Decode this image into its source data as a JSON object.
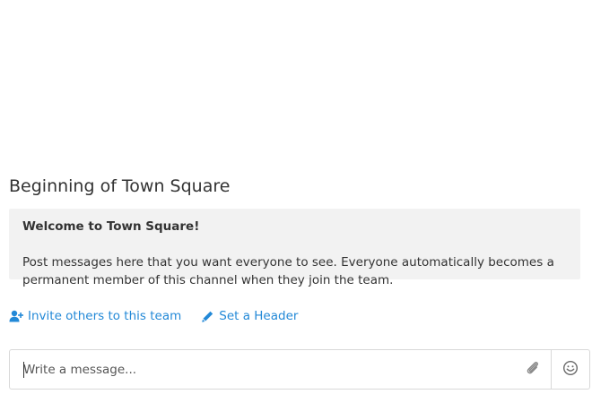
{
  "channel_intro": {
    "title": "Beginning of Town Square",
    "welcome": "Welcome to Town Square!",
    "description": "Post messages here that you want everyone to see. Everyone automatically becomes a permanent member of this channel when they join the team."
  },
  "actions": {
    "invite_label": "Invite others to this team",
    "invite_icon": "user-plus-icon",
    "header_label": "Set a Header",
    "header_icon": "pencil-icon"
  },
  "composer": {
    "placeholder": "Write a message...",
    "value": "",
    "attach_icon": "paperclip-icon",
    "emoji_icon": "smiley-icon"
  },
  "colors": {
    "link": "#2389d7",
    "intro_background": "#f2f2f2",
    "text": "#333333",
    "border": "#d8d8d8"
  }
}
